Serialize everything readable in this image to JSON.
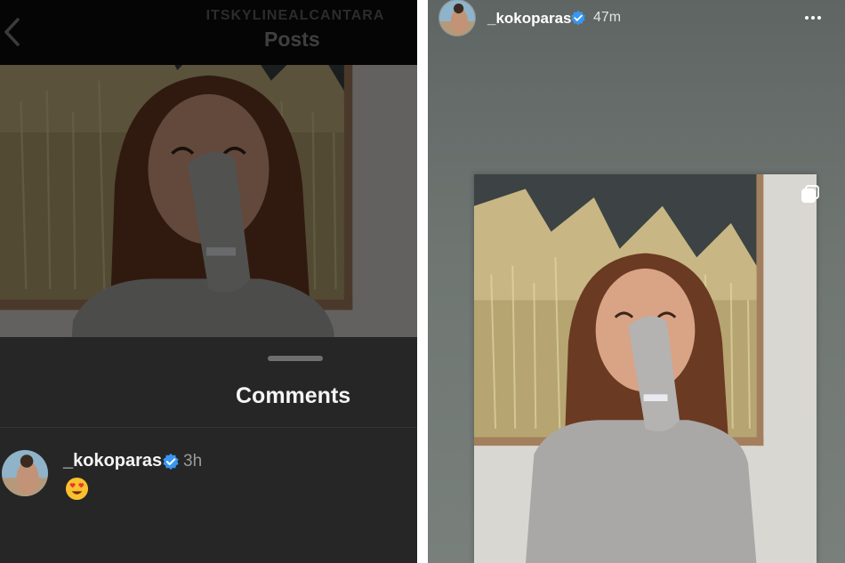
{
  "left_panel": {
    "header": {
      "username": "ITSKYLINEALCANTARA",
      "title": "Posts"
    },
    "comments_sheet": {
      "title": "Comments",
      "comments": [
        {
          "username": "_kokoparas",
          "verified": true,
          "time": "3h",
          "emoji_icon": "heart-eyes-emoji"
        }
      ]
    }
  },
  "right_panel": {
    "story": {
      "username": "_kokoparas",
      "verified": true,
      "time": "47m",
      "menu_icon": "more-horizontal-icon",
      "shared_post_icon": "multiple-photos-icon"
    }
  },
  "colors": {
    "verified_blue": "#3897f0",
    "dark_sheet": "#262626",
    "story_bg": "#6f7672"
  }
}
